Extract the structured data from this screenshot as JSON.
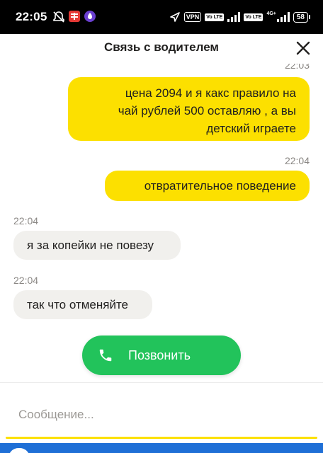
{
  "status_bar": {
    "time": "22:05",
    "vpn": "VPN",
    "volte1": "Vo LTE",
    "net": "4G+",
    "volte2": "Vo LTE",
    "battery": "58"
  },
  "header": {
    "title": "Связь с водителем",
    "close_icon": "close-icon"
  },
  "messages": [
    {
      "time": "22:03",
      "text_lines": [
        "цена 2094 и я какс правило на",
        "чай рублей 500 оставляю , а вы",
        "детский играете"
      ],
      "direction": "out"
    },
    {
      "time": "22:04",
      "text_lines": [
        "отвратительное поведение"
      ],
      "direction": "out"
    },
    {
      "time": "22:04",
      "text_lines": [
        "я за копейки не повезу"
      ],
      "direction": "in"
    },
    {
      "time": "22:04",
      "text_lines": [
        "так что отменяйте"
      ],
      "direction": "in"
    }
  ],
  "call_button": {
    "label": "Позвонить",
    "icon": "phone-icon"
  },
  "composer": {
    "placeholder": "Сообщение..."
  },
  "colors": {
    "accent": "#fce000",
    "call": "#22c35b",
    "incoming": "#f1f0ed"
  }
}
